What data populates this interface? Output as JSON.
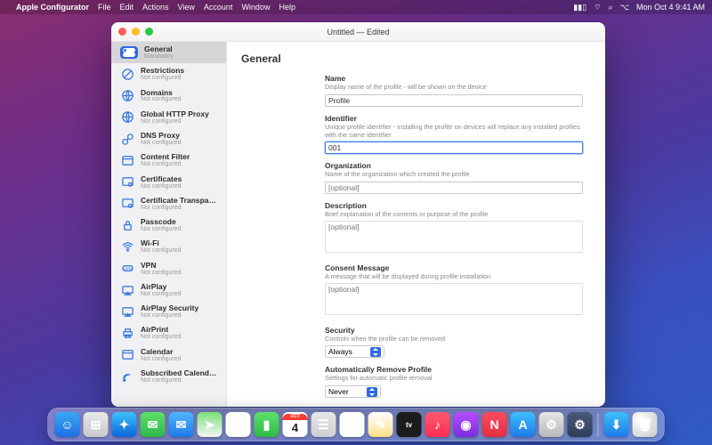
{
  "menubar": {
    "apple": "",
    "app_name": "Apple Configurator",
    "items": [
      "File",
      "Edit",
      "Actions",
      "View",
      "Account",
      "Window",
      "Help"
    ],
    "battery_icon": "battery-icon",
    "wifi_icon": "wifi-icon",
    "search_icon": "search-icon",
    "control_center_icon": "control-center-icon",
    "clock": "Mon Oct 4  9:41 AM"
  },
  "window": {
    "title": "Untitled — Edited"
  },
  "sidebar": {
    "items": [
      {
        "label": "General",
        "sub": "Mandatory",
        "icon": "toggle-icon",
        "selected": true
      },
      {
        "label": "Restrictions",
        "sub": "Not configured",
        "icon": "restrictions-icon"
      },
      {
        "label": "Domains",
        "sub": "Not configured",
        "icon": "globe-icon"
      },
      {
        "label": "Global HTTP Proxy",
        "sub": "Not configured",
        "icon": "globe-icon"
      },
      {
        "label": "DNS Proxy",
        "sub": "Not configured",
        "icon": "dns-icon"
      },
      {
        "label": "Content Filter",
        "sub": "Not configured",
        "icon": "filter-icon"
      },
      {
        "label": "Certificates",
        "sub": "Not configured",
        "icon": "certificate-icon"
      },
      {
        "label": "Certificate Transparency",
        "sub": "Not configured",
        "icon": "certificate-icon"
      },
      {
        "label": "Passcode",
        "sub": "Not configured",
        "icon": "lock-icon"
      },
      {
        "label": "Wi-Fi",
        "sub": "Not configured",
        "icon": "wifi-icon"
      },
      {
        "label": "VPN",
        "sub": "Not configured",
        "icon": "vpn-icon"
      },
      {
        "label": "AirPlay",
        "sub": "Not configured",
        "icon": "airplay-icon"
      },
      {
        "label": "AirPlay Security",
        "sub": "Not configured",
        "icon": "airplay-icon"
      },
      {
        "label": "AirPrint",
        "sub": "Not configured",
        "icon": "printer-icon"
      },
      {
        "label": "Calendar",
        "sub": "Not configured",
        "icon": "calendar-icon"
      },
      {
        "label": "Subscribed Calendars",
        "sub": "Not configured",
        "icon": "subscribed-cal-icon"
      }
    ]
  },
  "main": {
    "heading": "General",
    "fields": {
      "name": {
        "label": "Name",
        "desc": "Display name of the profile - will be shown on the device",
        "value": "Profile"
      },
      "identifier": {
        "label": "Identifier",
        "desc": "Unique profile identifier - installing the profile on devices will replace any installed profiles with the same identifier",
        "value": "001"
      },
      "organization": {
        "label": "Organization",
        "desc": "Name of the organization which created the profile",
        "placeholder": "[optional]"
      },
      "description": {
        "label": "Description",
        "desc": "Brief explanation of the contents or purpose of the profile",
        "placeholder": "[optional]"
      },
      "consent": {
        "label": "Consent Message",
        "desc": "A message that will be displayed during profile installation",
        "placeholder": "[optional]"
      },
      "security": {
        "label": "Security",
        "desc": "Controls when the profile can be removed",
        "value": "Always"
      },
      "autoremove": {
        "label": "Automatically Remove Profile",
        "desc": "Settings for automatic profile removal",
        "value": "Never"
      }
    }
  },
  "dock": {
    "apps": [
      {
        "name": "finder",
        "bg": "linear-gradient(#3ba7f5,#1e6fe0)",
        "glyph": "☺"
      },
      {
        "name": "launchpad",
        "bg": "linear-gradient(#e8e8ea,#c9c9cc)",
        "glyph": "⊞"
      },
      {
        "name": "safari",
        "bg": "linear-gradient(#3ec0ff,#0a66d8)",
        "glyph": "✦"
      },
      {
        "name": "messages",
        "bg": "linear-gradient(#5ee06a,#2fb84a)",
        "glyph": "✉"
      },
      {
        "name": "mail",
        "bg": "linear-gradient(#4fb6ff,#1e7ae8)",
        "glyph": "✉"
      },
      {
        "name": "maps",
        "bg": "linear-gradient(#7be07c,#f5f5f5)",
        "glyph": "➤"
      },
      {
        "name": "photos",
        "bg": "#fff",
        "glyph": "✿"
      },
      {
        "name": "facetime",
        "bg": "linear-gradient(#5ee06a,#2fb84a)",
        "glyph": "▮"
      },
      {
        "name": "calendar",
        "bg": "#fff",
        "glyph": "4",
        "badge": "OCT"
      },
      {
        "name": "contacts",
        "bg": "linear-gradient(#e6e6e8,#cfcfd1)",
        "glyph": "☰"
      },
      {
        "name": "reminders",
        "bg": "#fff",
        "glyph": "☰"
      },
      {
        "name": "notes",
        "bg": "linear-gradient(#fff,#ffe08a)",
        "glyph": "✎"
      },
      {
        "name": "tv",
        "bg": "#1c1c1e",
        "glyph": "tv"
      },
      {
        "name": "music",
        "bg": "linear-gradient(#ff5a6e,#ff2d55)",
        "glyph": "♪"
      },
      {
        "name": "podcasts",
        "bg": "linear-gradient(#b84aff,#7a2fe0)",
        "glyph": "◉"
      },
      {
        "name": "news",
        "bg": "linear-gradient(#ff4a5e,#e02f44)",
        "glyph": "N"
      },
      {
        "name": "appstore",
        "bg": "linear-gradient(#3ec0ff,#1e7ae8)",
        "glyph": "A"
      },
      {
        "name": "preferences",
        "bg": "linear-gradient(#e6e6e8,#b8b8ba)",
        "glyph": "⚙"
      },
      {
        "name": "configurator",
        "bg": "linear-gradient(#4a5a7a,#2f3d5a)",
        "glyph": "⚙"
      }
    ],
    "right": [
      {
        "name": "downloads",
        "bg": "linear-gradient(#3ec0ff,#1e7ae8)",
        "glyph": "⬇"
      },
      {
        "name": "trash",
        "bg": "",
        "glyph": "🗑"
      }
    ]
  }
}
